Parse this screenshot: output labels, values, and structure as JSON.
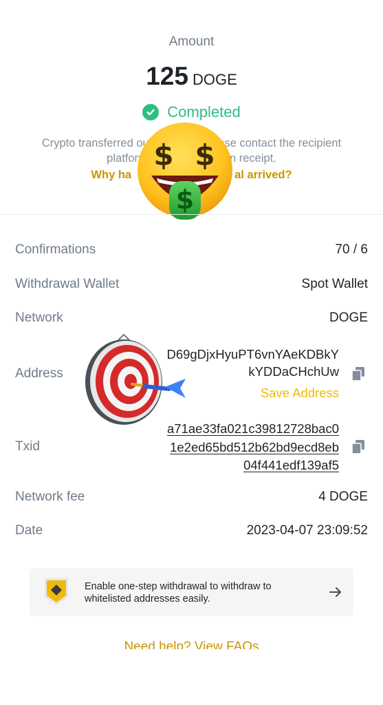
{
  "header": {
    "amount_label": "Amount",
    "amount_value": "125",
    "amount_unit": "DOGE",
    "status": "Completed",
    "info_line1": "Crypto transferred out",
    "info_line1_end": "ase contact the recipient",
    "info_line2": "platform",
    "info_line2_end": "on receipt.",
    "why_link_start": "Why ha",
    "why_link_end": "al arrived?"
  },
  "details": {
    "confirmations_label": "Confirmations",
    "confirmations_value": "70 / 6",
    "wallet_label": "Withdrawal Wallet",
    "wallet_value": "Spot Wallet",
    "network_label": "Network",
    "network_value": "DOGE",
    "address_label": "Address",
    "address_line1": "D69gDjxHyuPT6vnYAeKDBkY",
    "address_line2": "kYDDaCHchUw",
    "save_address": "Save Address",
    "txid_label": "Txid",
    "txid_lines": [
      "a71ae33fa021c39812728bac0",
      "1e2ed65bd512b62bd9ecd8eb",
      "04f441edf139af5"
    ],
    "fee_label": "Network fee",
    "fee_value": "4 DOGE",
    "date_label": "Date",
    "date_value": "2023-04-07 23:09:52"
  },
  "banner": {
    "line1": "Enable one-step withdrawal to withdraw to",
    "line2": "whitelisted addresses easily.",
    "icon": "shield-icon",
    "arrow": "arrow-right-icon"
  },
  "footer": {
    "help_link": "Need help? View FAQs"
  },
  "overlays": {
    "emoji_face": "money-mouth-face-emoji",
    "dartboard": "direct-hit-emoji"
  },
  "colors": {
    "success": "#2ebd85",
    "link_gold": "#c99400",
    "save_yellow": "#f0b90b",
    "muted": "#707a8a"
  }
}
